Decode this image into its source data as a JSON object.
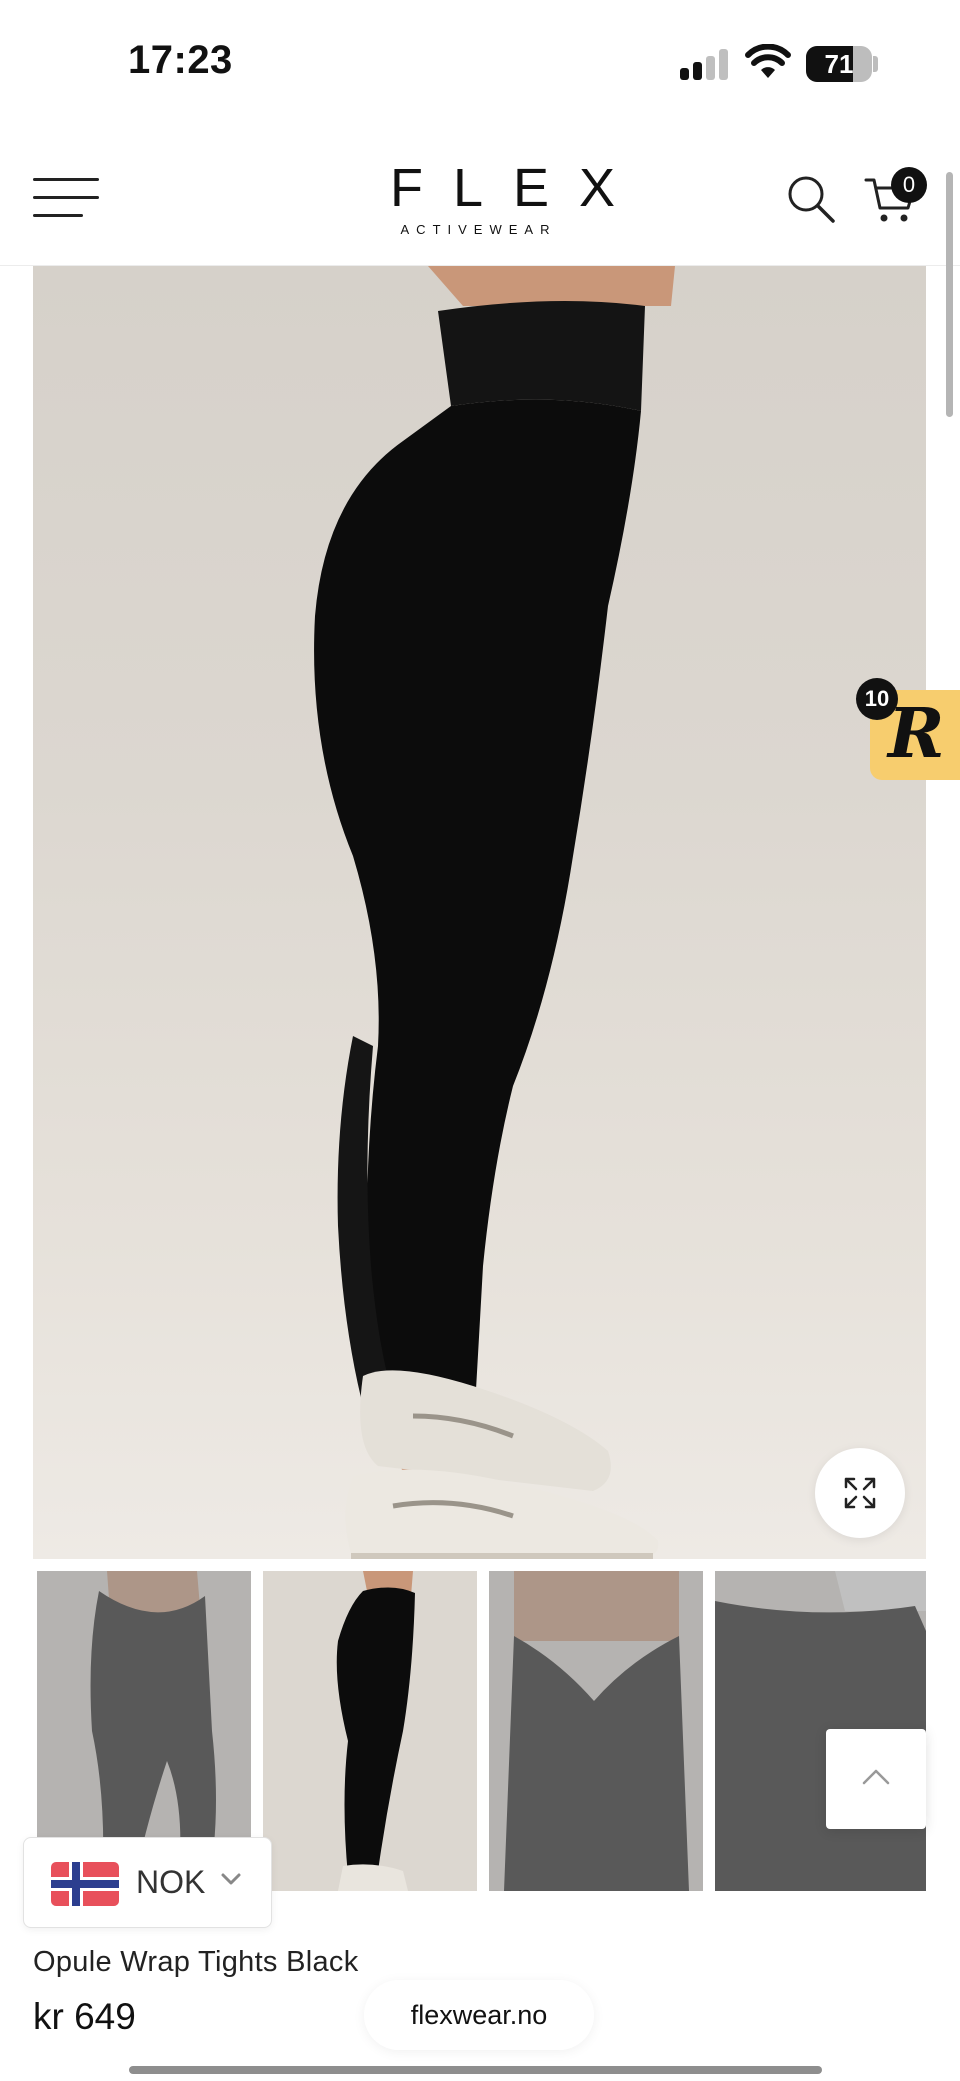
{
  "status_bar": {
    "time": "17:23",
    "battery_percent": "71",
    "battery_level": 0.71,
    "signal_bars_active": 2,
    "signal_bars_total": 4
  },
  "header": {
    "logo_text": "FLEX",
    "logo_subtext": "ACTIVEWEAR",
    "cart_count": "0",
    "icons": [
      "menu-icon",
      "search-icon",
      "cart-icon"
    ]
  },
  "rewards": {
    "letter": "R",
    "count": "10",
    "color": "#f7cd6e"
  },
  "gallery": {
    "thumbnails": [
      "thumb-1",
      "thumb-2",
      "thumb-3",
      "thumb-4"
    ],
    "active_thumbnail": 2,
    "icons": [
      "expand-icon",
      "chevron-up-icon"
    ]
  },
  "currency": {
    "code": "NOK",
    "flag": "norway-flag-icon"
  },
  "product": {
    "title": "Opule Wrap Tights Black",
    "price": "kr 649"
  },
  "browser": {
    "domain": "flexwear.no"
  }
}
